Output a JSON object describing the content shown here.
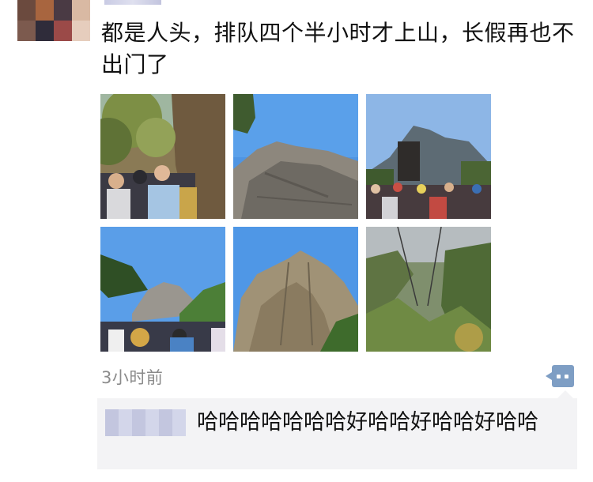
{
  "post": {
    "text": "都是人头，排队四个半小时才上山，长假再也不出门了",
    "timestamp": "3小时前"
  },
  "photos": [
    {
      "name": "crowd-trail-photo",
      "icon": "photo-thumbnail"
    },
    {
      "name": "granite-rock-photo",
      "icon": "photo-thumbnail"
    },
    {
      "name": "crowd-peak-photo",
      "icon": "photo-thumbnail"
    },
    {
      "name": "pine-cliff-crowd-photo",
      "icon": "photo-thumbnail"
    },
    {
      "name": "mountain-peak-photo",
      "icon": "photo-thumbnail"
    },
    {
      "name": "cable-car-valley-photo",
      "icon": "photo-thumbnail"
    }
  ],
  "comment": {
    "text": "哈哈哈哈哈哈哈好哈哈好哈哈好哈哈"
  },
  "colors": {
    "comment_button": "#7e9ec4",
    "comment_background": "#f3f3f5",
    "timestamp": "#8b8b8b"
  }
}
